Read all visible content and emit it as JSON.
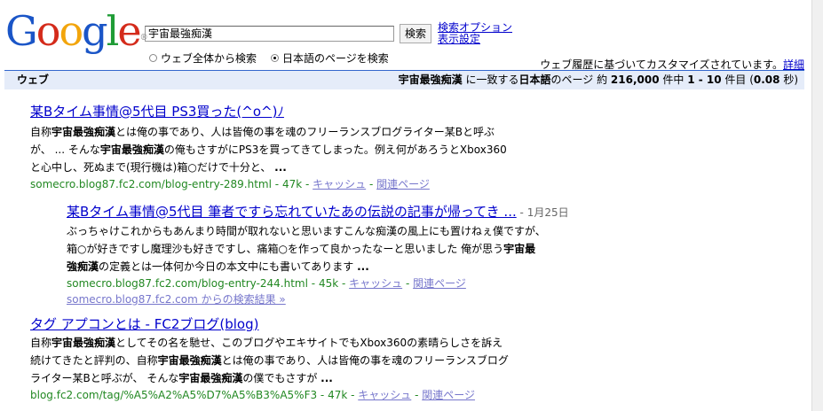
{
  "logo": {
    "letters": [
      "G",
      "o",
      "o",
      "g",
      "l",
      "e"
    ],
    "tm": "®",
    "colors": [
      "#1a55c7",
      "#d42b1b",
      "#f2a50c",
      "#1a55c7",
      "#1f9c36",
      "#d42b1b"
    ]
  },
  "search": {
    "query": "宇宙最強痴漢",
    "button": "検索",
    "advanced_link": "検索オプション",
    "prefs_link": "表示設定"
  },
  "scope": {
    "web_label": "ウェブ全体から検索",
    "japanese_label": "日本語のページを検索",
    "selected": "japanese"
  },
  "personalized": {
    "text": "ウェブ履歴に基づいてカスタマイズされています。",
    "link": "詳細"
  },
  "resultbar": {
    "label": "ウェブ",
    "query": "宇宙最強痴漢",
    "t1": " に一致する",
    "lang": "日本語",
    "t2": "のページ 約 ",
    "total": "216,000",
    "t3": " 件中 ",
    "range": "1 - 10",
    "t4": " 件目 (",
    "time": "0.08",
    "t5": " 秒)"
  },
  "results": [
    {
      "title": "某Bタイム事情@5代目 PS3買った(^o^)ﾉ",
      "snippet": [
        [
          "自称",
          ""
        ],
        [
          "宇宙最強痴漢",
          "b"
        ],
        [
          "とは俺の事であり、人は皆俺の事を魂のフリーランスブログライター某Bと呼ぶが、 ... そんな",
          ""
        ],
        [
          "宇宙最強痴漢",
          "b"
        ],
        [
          "の俺もさすがにPS3を買ってきてしまった。例え何があろうとXbox360と心中し、死ぬまで(現行機は)箱○だけで十分と、 ",
          ""
        ],
        [
          "...",
          "b"
        ]
      ],
      "url": "somecro.blog87.fc2.com/blog-entry-289.html",
      "size": "47k",
      "cache": "キャッシュ",
      "related": "関連ページ"
    },
    {
      "title": "某Bタイム事情@5代目 筆者ですら忘れていたあの伝説の記事が帰ってき ...",
      "date": "1月25日",
      "snippet": [
        [
          "ぶっちゃけこれからもあんまり時間が取れないと思いますこんな痴漢の風上にも置けねぇ僕ですが、箱○が好きですし魔理沙も好きですし、痛箱○を作って良かったなーと思いました 俺が思う",
          ""
        ],
        [
          "宇宙最強痴漢",
          "b"
        ],
        [
          "の定義とは一体何か今日の本文中にも書いてあります ",
          ""
        ],
        [
          "...",
          "b"
        ]
      ],
      "url": "somecro.blog87.fc2.com/blog-entry-244.html",
      "size": "45k",
      "cache": "キャッシュ",
      "related": "関連ページ",
      "more": "somecro.blog87.fc2.com からの検索結果 »"
    },
    {
      "title": "タグ アプコンとは - FC2ブログ(blog)",
      "snippet": [
        [
          "自称",
          ""
        ],
        [
          "宇宙最強痴漢",
          "b"
        ],
        [
          "としてその名を馳せ、このブログやエキサイトでもXbox360の素晴らしさを訴え続けてきたと評判の、自称",
          ""
        ],
        [
          "宇宙最強痴漢",
          "b"
        ],
        [
          "とは俺の事であり、人は皆俺の事を魂のフリーランスブログライター某Bと呼ぶが、 そんな",
          ""
        ],
        [
          "宇宙最強痴漢",
          "b"
        ],
        [
          "の僕でもさすが ",
          ""
        ],
        [
          "...",
          "b"
        ]
      ],
      "url": "blog.fc2.com/tag/%A5%A2%A5%D7%A5%B3%A5%F3",
      "size": "47k",
      "cache": "キャッシュ",
      "related": "関連ページ"
    }
  ],
  "cite_sep": " - "
}
